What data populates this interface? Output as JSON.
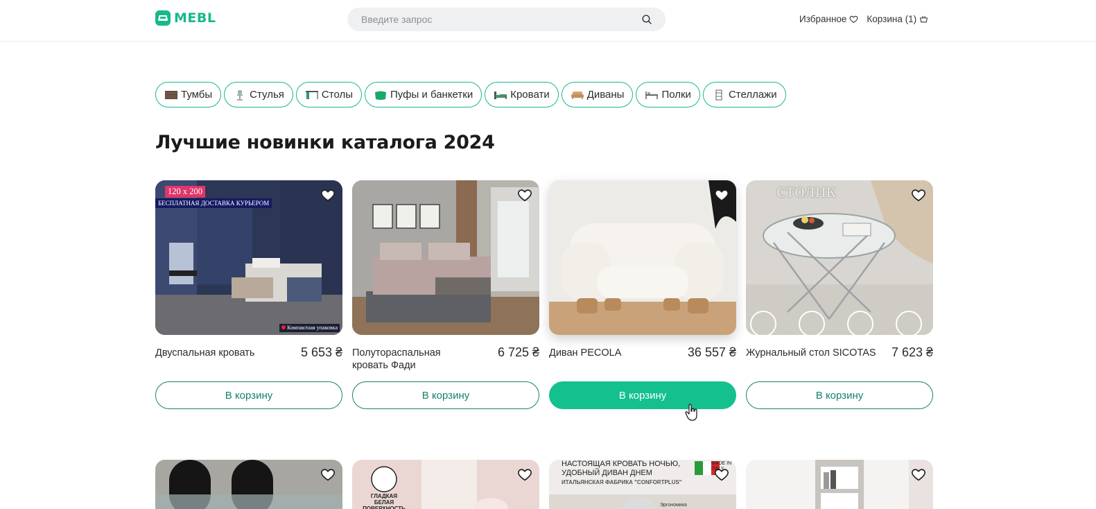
{
  "header": {
    "logo_text": "MEBL",
    "search_placeholder": "Введите запрос",
    "favorites_label": "Избранное",
    "cart_label": "Корзина (1)"
  },
  "categories": [
    {
      "label": "Тумбы",
      "icon": "nightstand-icon"
    },
    {
      "label": "Стулья",
      "icon": "chair-icon"
    },
    {
      "label": "Столы",
      "icon": "table-icon"
    },
    {
      "label": "Пуфы и банкетки",
      "icon": "pouf-icon"
    },
    {
      "label": "Кровати",
      "icon": "bed-icon"
    },
    {
      "label": "Диваны",
      "icon": "sofa-icon"
    },
    {
      "label": "Полки",
      "icon": "shelf-icon"
    },
    {
      "label": "Стеллажи",
      "icon": "rack-icon"
    }
  ],
  "section_title": "Лучшие новинки каталога 2024",
  "products": [
    {
      "name": "Двуспальная кровать",
      "price": "5 653 ₴",
      "button": "В корзину",
      "badge_size": "120 x 200",
      "badge_delivery": "БЕСПЛАТНАЯ ДОСТАВКА КУРЬЕРОМ",
      "badge_pack": "Компактная упаковка"
    },
    {
      "name": "Полутораспальная кровать Фади",
      "price": "6 725 ₴",
      "button": "В корзину"
    },
    {
      "name": "Диван PECOLA",
      "price": "36 557 ₴",
      "button": "В корзину"
    },
    {
      "name": "Журнальный стол SICOTAS",
      "price": "7 623 ₴",
      "button": "В корзину",
      "overlay_text": "столик"
    }
  ],
  "products_row2": [
    {
      "overlay_text": ""
    },
    {
      "overlay_text": "ГЛАДКАЯ БЕЛАЯ ПОВЕРХНОСТЬ"
    },
    {
      "overlay_text": "НАСТОЯЩАЯ КРОВАТЬ НОЧЬЮ, УДОБНЫЙ ДИВАН ДНЕМ",
      "overlay_sub": "ИТАЛЬЯНСКАЯ ФАБРИКА \"CONFORTPLUS\"",
      "overlay_made": "MADE IN ITALY",
      "overlay_ergo": "Эргономика посадки"
    },
    {
      "overlay_text": ""
    }
  ],
  "colors": {
    "accent": "#16b98c",
    "button_active": "#14c08e",
    "button_border": "#17806a"
  }
}
